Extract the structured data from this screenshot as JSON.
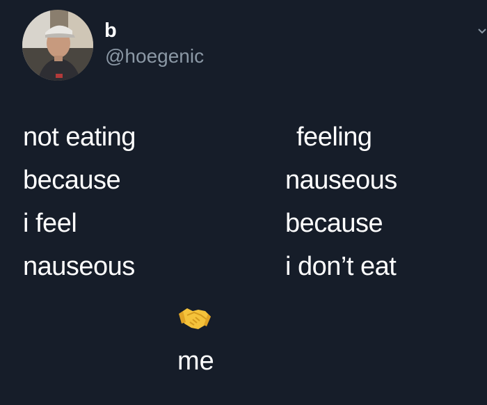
{
  "tweet": {
    "display_name": "b",
    "handle": "@hoegenic",
    "left_lines": [
      "not eating",
      "because",
      "i feel",
      "nauseous"
    ],
    "right_lines": [
      "feeling",
      "nauseous",
      "because",
      "i don’t eat"
    ],
    "bottom_label": "me",
    "icons": {
      "avatar": "profile-photo",
      "handshake": "handshake-emoji",
      "more": "chevron-down-icon"
    }
  },
  "colors": {
    "background": "#161d29",
    "text": "#ffffff",
    "handle": "#8b98a5"
  }
}
